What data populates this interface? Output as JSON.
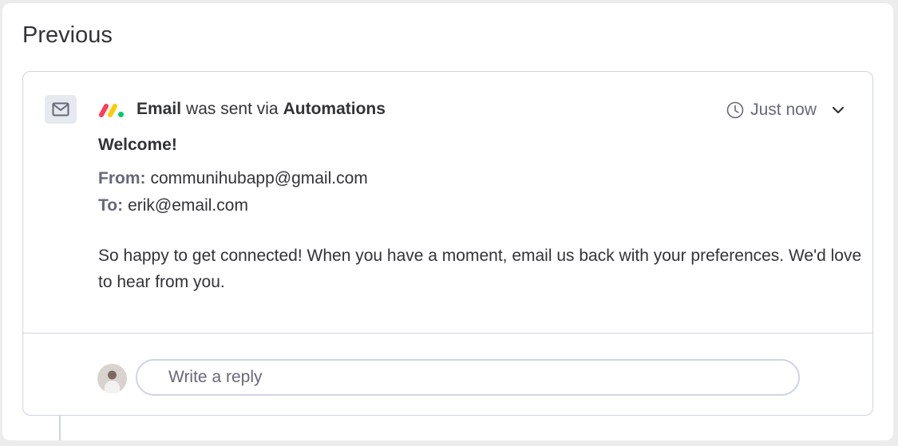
{
  "section": {
    "title": "Previous"
  },
  "update": {
    "icon": "envelope-icon",
    "logo": "monday-logo",
    "header": {
      "part1": "Email",
      "part2": "was sent via",
      "part3": "Automations"
    },
    "time": {
      "icon": "clock-icon",
      "label": "Just now"
    },
    "expand_icon": "chevron-down-icon",
    "subject": "Welcome!",
    "from": {
      "label": "From:",
      "value": "communihubapp@gmail.com"
    },
    "to": {
      "label": "To:",
      "value": "erik@email.com"
    },
    "body": "So happy to get connected! When you have a moment, email us back with your preferences. We'd love to hear from you."
  },
  "reply": {
    "avatar": "user-avatar",
    "placeholder": "Write a reply"
  },
  "colors": {
    "logo_red": "#ff3d57",
    "logo_yellow": "#ffcb00",
    "logo_green": "#00ca72",
    "border": "#d0d4e4",
    "secondary_text": "#676879",
    "primary_text": "#323338"
  }
}
